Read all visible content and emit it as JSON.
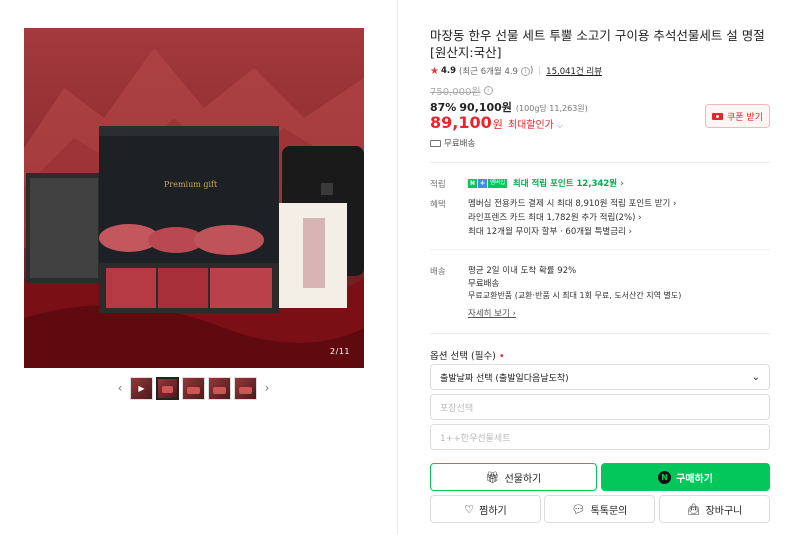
{
  "gallery": {
    "counter": "2/11",
    "box_text": "Premium gift",
    "prev_label": "‹",
    "next_label": "›",
    "thumbnail_count": 5,
    "active_thumbnail": 2
  },
  "product": {
    "title": "마장동 한우 선물 세트 투뿔 소고기 구이용 추석선물세트 설 명절 [원산지:국산]",
    "rating_score": "4.9",
    "rating_recent": "(최근 6개월 4.9",
    "rating_recent_close": ")",
    "review_count": "15,041건 리뷰",
    "original_price": "750,000원",
    "discount_rate": "87%",
    "sale_price": "90,100원",
    "unit_price": "(100g당 11,263원)",
    "max_discount_price": "89,100",
    "won": "원",
    "max_discount_label": "최대할인가",
    "coupon_button": "쿠폰 받기",
    "shipping_tag": "무료배송"
  },
  "benefits": {
    "points_label": "적립",
    "points_badge_n": "N",
    "points_badge_plus": "+",
    "points_badge_m": "멤버십",
    "points_text": "최대 적립 포인트 12,342원 ›",
    "perks_label": "혜택",
    "perks": [
      "멤버십 전용카드 결제 시 최대 8,910원 적립 포인트 받기 ›",
      "라인프렌즈 카드 최대 1,782원 추가 적립(2%) ›",
      "최대 12개월 무이자 할부 · 60개월 특별금리 ›"
    ]
  },
  "delivery": {
    "label": "배송",
    "lines": [
      "평균 2일 이내 도착 확률 92%",
      "무료배송",
      "무료교환반품 (교환·반품 시 최대 1회 무료, 도서산간 지역 별도)"
    ],
    "detail_link": "자세히 보기 ›"
  },
  "options": {
    "label": "옵션 선택 (필수)",
    "required_mark": "•",
    "select1": "출발날짜 선택 (출발일다음날도착)",
    "select2": "포장선택",
    "select3": "1++한우선물세트"
  },
  "actions": {
    "gift": "선물하기",
    "buy": "구매하기",
    "wish": "찜하기",
    "talk": "톡톡문의",
    "cart": "장바구니"
  },
  "colors": {
    "accent_green": "#03c75a",
    "price_red": "#e5262a"
  }
}
